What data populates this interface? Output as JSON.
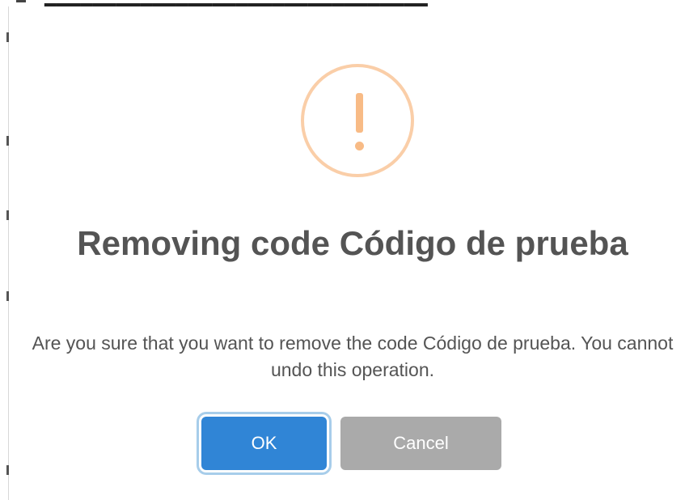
{
  "dialog": {
    "icon": "warning-exclamation-icon",
    "title": "Removing code Código de prueba",
    "message": "Are you sure that you want to remove the code Código de prueba. You cannot undo this operation.",
    "buttons": {
      "ok_label": "OK",
      "cancel_label": "Cancel"
    }
  },
  "colors": {
    "icon_ring": "#facea8",
    "icon_mark": "#f8bb86",
    "text": "#545454",
    "ok_button": "#3085d6",
    "ok_focus_ring": "#a7cdea",
    "cancel_button": "#aaaaaa"
  }
}
